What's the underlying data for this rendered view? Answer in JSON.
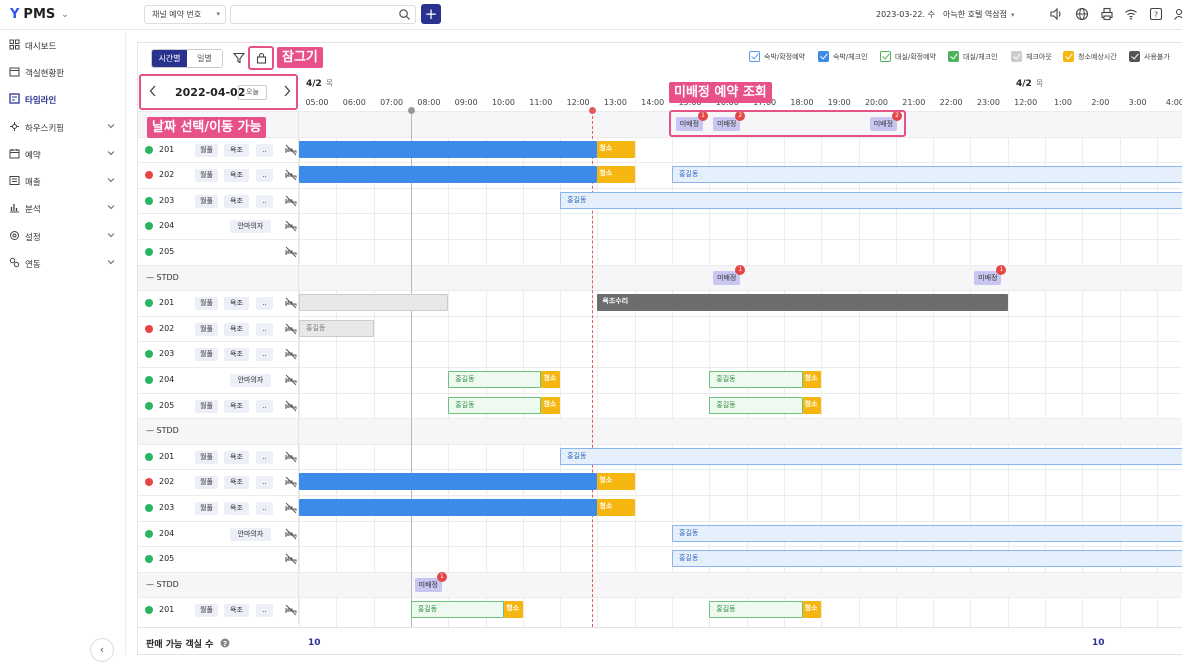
{
  "top": {
    "logo": "PMS",
    "channel_select": "채널 예약 번호",
    "search_placeholder": "",
    "add_label": "+",
    "date": "2023-03-22. 수",
    "hotel": "아늑한 호텔 역삼점"
  },
  "sidebar": {
    "items": [
      {
        "label": "대시보드",
        "icon": "grid-icon"
      },
      {
        "label": "객실현황판",
        "icon": "calendar-icon"
      },
      {
        "label": "타임라인",
        "icon": "timeline-icon"
      },
      {
        "label": "하우스키핑",
        "icon": "housekeeping-icon"
      },
      {
        "label": "예약",
        "icon": "reservation-icon"
      },
      {
        "label": "매출",
        "icon": "sales-icon"
      },
      {
        "label": "분석",
        "icon": "chart-icon"
      },
      {
        "label": "설정",
        "icon": "settings-icon"
      },
      {
        "label": "연동",
        "icon": "link-icon"
      }
    ],
    "collapse": "‹"
  },
  "toolbar": {
    "view_time": "시간별",
    "view_day": "일별",
    "lock_label": "잠그기",
    "date": "2022-04-02",
    "today": "오늘",
    "date_hint": "날짜 선택/이동 가능",
    "unassigned_hint": "미배정 예약 조회"
  },
  "legend": [
    {
      "label": "숙박/확정예약",
      "color": "#5b9be6",
      "fill": false
    },
    {
      "label": "숙박/체크인",
      "color": "#3d8ae8",
      "fill": true
    },
    {
      "label": "대실/확정예약",
      "color": "#4cb35c",
      "fill": false
    },
    {
      "label": "대실/체크인",
      "color": "#4cb35c",
      "fill": true
    },
    {
      "label": "체크아웃",
      "color": "#cccccc",
      "fill": true
    },
    {
      "label": "청소예상시간",
      "color": "#f5b70f",
      "fill": true
    },
    {
      "label": "사용불가",
      "color": "#555555",
      "fill": true
    }
  ],
  "timeline": {
    "day1": {
      "date": "4/2",
      "dow": "목"
    },
    "day2": {
      "date": "4/2",
      "dow": "목"
    },
    "hours": [
      "05:00",
      "06:00",
      "07:00",
      "08:00",
      "09:00",
      "10:00",
      "11:00",
      "12:00",
      "13:00",
      "14:00",
      "15:00",
      "16:00",
      "17:00",
      "18:00",
      "19:00",
      "20:00",
      "21:00",
      "22:00",
      "23:00",
      "12:00",
      "1:00",
      "2:00",
      "3:00",
      "4:00"
    ]
  },
  "labels": {
    "unassigned": "미배정",
    "clean": "청소",
    "guest": "홍길동",
    "repair": "욕조수리",
    "group": "STDD",
    "ellipsis": ".."
  },
  "tags": {
    "t1": "월풀",
    "t2": "욕조",
    "t3": "안마의자"
  },
  "rows": [
    {
      "type": "unassigned",
      "badges": [
        "1",
        "2",
        "2"
      ]
    },
    {
      "type": "room",
      "no": "201",
      "status": "green",
      "tags": [
        "월풀",
        "욕조"
      ]
    },
    {
      "type": "room",
      "no": "202",
      "status": "red",
      "tags": [
        "월풀",
        "욕조"
      ]
    },
    {
      "type": "room",
      "no": "203",
      "status": "green",
      "tags": [
        "월풀",
        "욕조"
      ]
    },
    {
      "type": "room",
      "no": "204",
      "status": "green",
      "tags": [
        "안마의자"
      ]
    },
    {
      "type": "room",
      "no": "205",
      "status": "green",
      "tags": []
    },
    {
      "type": "group",
      "name": "STDD",
      "badges": [
        "1",
        "1"
      ]
    },
    {
      "type": "room",
      "no": "201",
      "status": "green",
      "tags": [
        "월풀",
        "욕조"
      ]
    },
    {
      "type": "room",
      "no": "202",
      "status": "red",
      "tags": [
        "월풀",
        "욕조"
      ]
    },
    {
      "type": "room",
      "no": "203",
      "status": "green",
      "tags": [
        "월풀",
        "욕조"
      ]
    },
    {
      "type": "room",
      "no": "204",
      "status": "green",
      "tags": [
        "안마의자"
      ]
    },
    {
      "type": "room",
      "no": "205",
      "status": "green",
      "tags": [
        "월풀",
        "욕조"
      ]
    },
    {
      "type": "group",
      "name": "STDD"
    },
    {
      "type": "room",
      "no": "201",
      "status": "green",
      "tags": [
        "월풀",
        "욕조"
      ]
    },
    {
      "type": "room",
      "no": "202",
      "status": "red",
      "tags": [
        "월풀",
        "욕조"
      ]
    },
    {
      "type": "room",
      "no": "203",
      "status": "green",
      "tags": [
        "월풀",
        "욕조"
      ]
    },
    {
      "type": "room",
      "no": "204",
      "status": "green",
      "tags": [
        "안마의자"
      ]
    },
    {
      "type": "room",
      "no": "205",
      "status": "green",
      "tags": []
    },
    {
      "type": "group",
      "name": "STDD",
      "badges": [
        "1"
      ]
    },
    {
      "type": "room",
      "no": "201",
      "status": "green",
      "tags": [
        "월풀",
        "욕조"
      ]
    }
  ],
  "footer": {
    "label": "판매 가능 객실 수",
    "v1": "10",
    "v2": "10"
  }
}
